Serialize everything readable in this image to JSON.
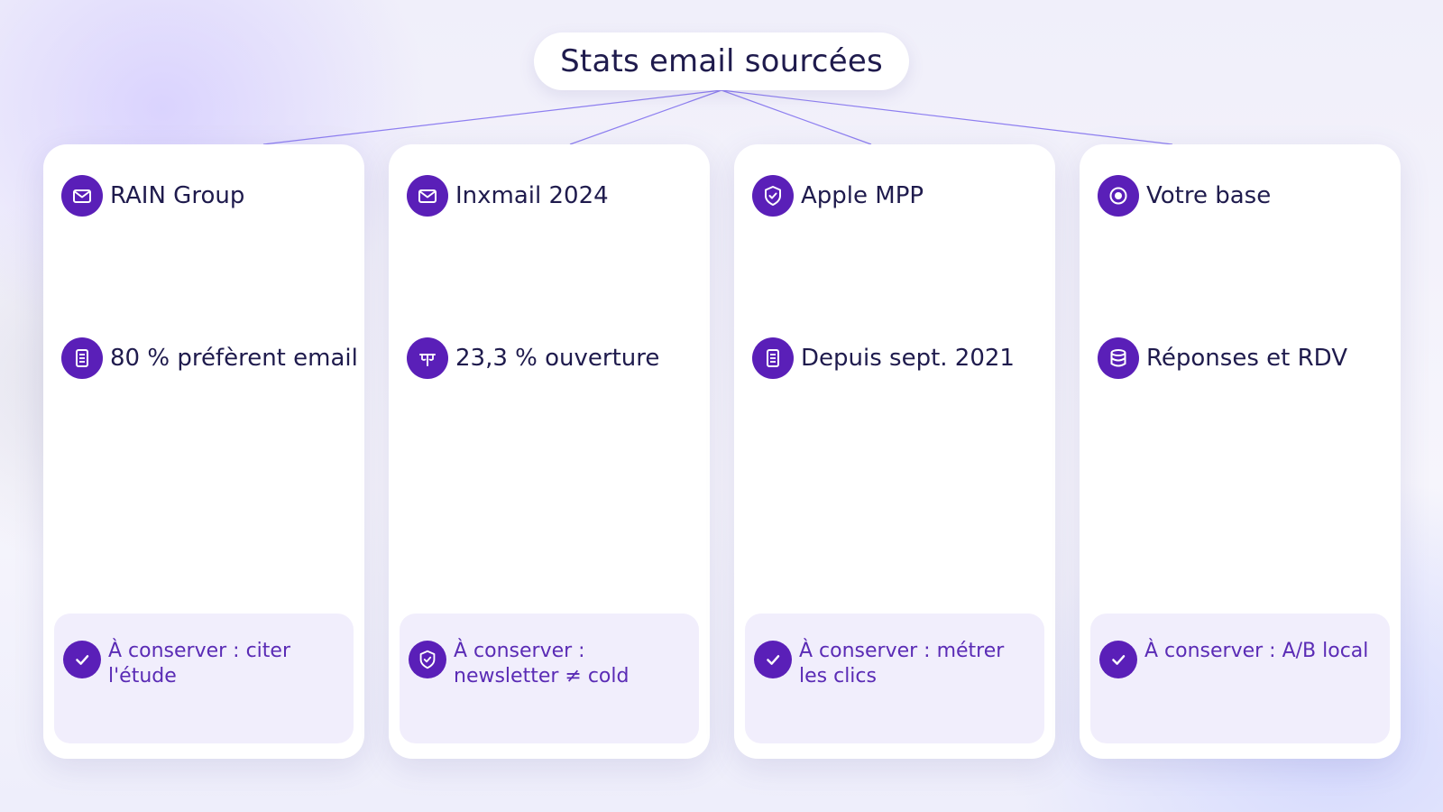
{
  "title": "Stats email sourcées",
  "colors": {
    "accent": "#5a1fb8",
    "text": "#1f1b4d",
    "keep_text": "#5a2bb5",
    "keep_bg": "#f1eefc",
    "connector": "#8e7ff0"
  },
  "cards": [
    {
      "source": "RAIN Group",
      "source_icon": "mail-icon",
      "stat": "80 % préfèrent email",
      "stat_icon": "document-icon",
      "keep": "À conserver : citer l'étude",
      "keep_icon": "check-icon"
    },
    {
      "source": "Inxmail 2024",
      "source_icon": "mail-icon",
      "stat": "23,3 % ouverture",
      "stat_icon": "scale-icon",
      "keep": "À conserver : newsletter ≠ cold",
      "keep_icon": "shield-check-icon"
    },
    {
      "source": "Apple MPP",
      "source_icon": "shield-check-icon",
      "stat": "Depuis sept. 2021",
      "stat_icon": "document-icon",
      "keep": "À conserver : métrer les clics",
      "keep_icon": "check-icon"
    },
    {
      "source": "Votre base",
      "source_icon": "target-icon",
      "stat": "Réponses et RDV",
      "stat_icon": "database-icon",
      "keep": "À conserver : A/B local",
      "keep_icon": "check-icon"
    }
  ]
}
